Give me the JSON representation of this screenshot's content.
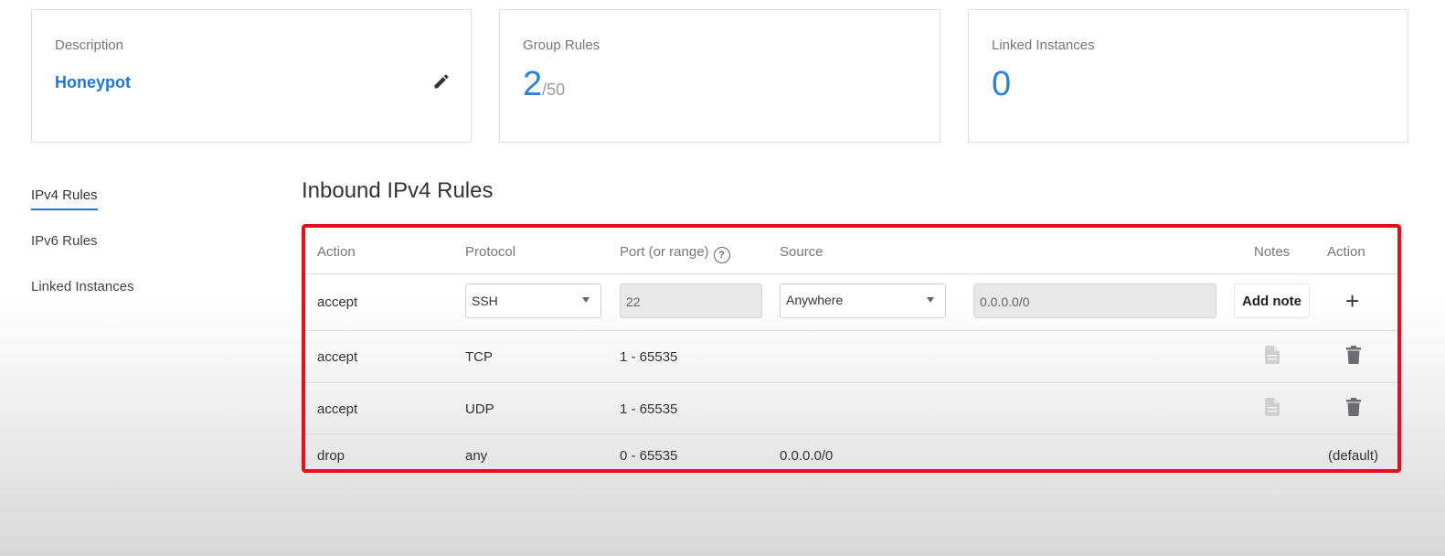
{
  "cards": {
    "description": {
      "label": "Description",
      "value": "Honeypot"
    },
    "group_rules": {
      "label": "Group Rules",
      "count": "2",
      "limit": "/50"
    },
    "linked_instances": {
      "label": "Linked Instances",
      "count": "0"
    }
  },
  "sidenav": {
    "items": [
      "IPv4 Rules",
      "IPv6 Rules",
      "Linked Instances"
    ],
    "active": "IPv4 Rules"
  },
  "section_title": "Inbound IPv4 Rules",
  "table": {
    "headers": {
      "action": "Action",
      "protocol": "Protocol",
      "port": "Port (or range)",
      "source": "Source",
      "notes": "Notes",
      "action2": "Action"
    },
    "new_rule": {
      "action": "accept",
      "protocol_selected": "SSH",
      "port_value": "22",
      "source_selected": "Anywhere",
      "source_cidr": "0.0.0.0/0",
      "add_note_label": "Add note",
      "add_symbol": "+"
    },
    "rows": [
      {
        "action": "accept",
        "protocol": "TCP",
        "port": "1 - 65535",
        "source": ""
      },
      {
        "action": "accept",
        "protocol": "UDP",
        "port": "1 - 65535",
        "source": ""
      },
      {
        "action": "drop",
        "protocol": "any",
        "port": "0 - 65535",
        "source": "0.0.0.0/0",
        "tag": "(default)"
      }
    ]
  },
  "colors": {
    "accent": "#1e78d7",
    "highlight_border": "#e3101b",
    "icon_gray": "#6b6b74",
    "note_icon": "#cfcfcf"
  },
  "icons": [
    "pencil-icon",
    "help-icon",
    "dropdown-arrow-icon",
    "plus-icon",
    "note-icon",
    "trash-icon"
  ]
}
